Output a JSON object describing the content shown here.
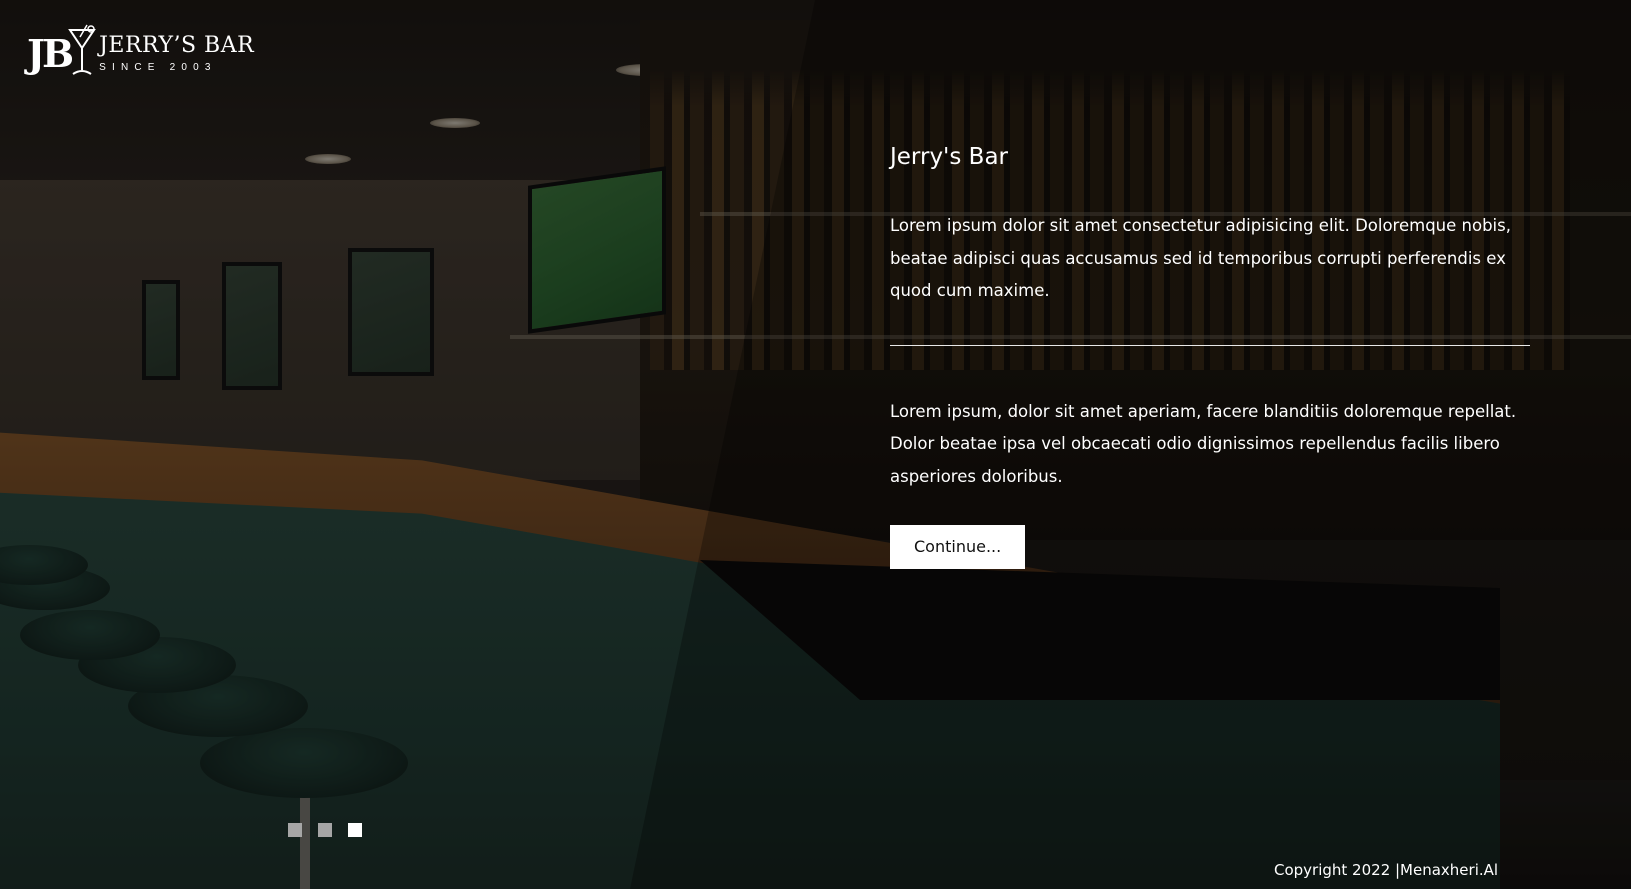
{
  "logo": {
    "monogram": "JB",
    "name": "JERRY’S BAR",
    "tagline": "SINCE 2003"
  },
  "main": {
    "title": "Jerry's Bar",
    "paragraph_1": "Lorem ipsum dolor sit amet consectetur adipisicing elit. Doloremque nobis, beatae adipisci quas accusamus sed id temporibus corrupti perferendis ex quod cum maxime.",
    "paragraph_2": "Lorem ipsum, dolor sit amet aperiam, facere blanditiis doloremque repellat. Dolor beatae ipsa vel obcaecati odio dignissimos repellendus facilis libero asperiores doloribus.",
    "button_label": "Continue..."
  },
  "slider": {
    "active_index": 3
  },
  "footer": {
    "copyright": "Copyright 2022 |Menaxheri.Al"
  },
  "colors": {
    "button_bg": "#ffffff",
    "dot_inactive": "#a6a6a6",
    "dot_active": "#ffffff",
    "overlay": "rgba(0,0,0,0.42)"
  }
}
